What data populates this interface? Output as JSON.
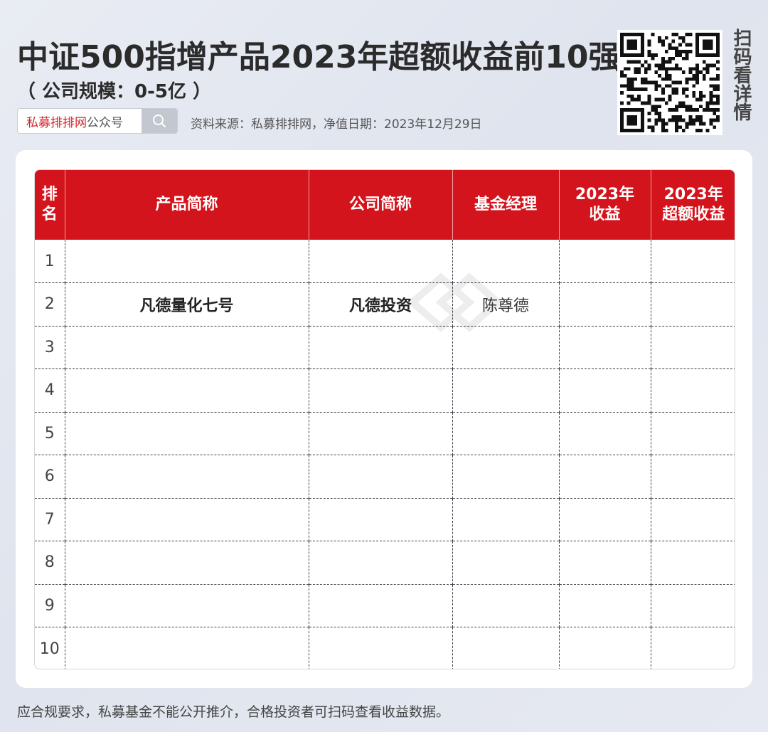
{
  "header": {
    "title": "中证500指增产品2023年超额收益前10强",
    "subtitle": "（ 公司规模：0-5亿 ）",
    "search_brand": "私募排排网",
    "search_suffix": "公众号",
    "source": "资料来源：私募排排网，净值日期：2023年12月29日",
    "scan_label": "扫码看详情"
  },
  "table": {
    "headers": [
      "排名",
      "产品简称",
      "公司简称",
      "基金经理",
      "2023年收益",
      "2023年超额收益"
    ],
    "header_lines": [
      [
        "排",
        "名"
      ],
      [
        "产品简称"
      ],
      [
        "公司简称"
      ],
      [
        "基金经理"
      ],
      [
        "2023年",
        "收益"
      ],
      [
        "2023年",
        "超额收益"
      ]
    ],
    "rows": [
      {
        "rank": "1",
        "product": "",
        "company": "",
        "manager": "",
        "return": "",
        "excess": ""
      },
      {
        "rank": "2",
        "product": "凡德量化七号",
        "company": "凡德投资",
        "manager": "陈尊德",
        "return": "",
        "excess": ""
      },
      {
        "rank": "3",
        "product": "",
        "company": "",
        "manager": "",
        "return": "",
        "excess": ""
      },
      {
        "rank": "4",
        "product": "",
        "company": "",
        "manager": "",
        "return": "",
        "excess": ""
      },
      {
        "rank": "5",
        "product": "",
        "company": "",
        "manager": "",
        "return": "",
        "excess": ""
      },
      {
        "rank": "6",
        "product": "",
        "company": "",
        "manager": "",
        "return": "",
        "excess": ""
      },
      {
        "rank": "7",
        "product": "",
        "company": "",
        "manager": "",
        "return": "",
        "excess": ""
      },
      {
        "rank": "8",
        "product": "",
        "company": "",
        "manager": "",
        "return": "",
        "excess": ""
      },
      {
        "rank": "9",
        "product": "",
        "company": "",
        "manager": "",
        "return": "",
        "excess": ""
      },
      {
        "rank": "10",
        "product": "",
        "company": "",
        "manager": "",
        "return": "",
        "excess": ""
      }
    ]
  },
  "footer": {
    "note": "应合规要求，私募基金不能公开推介，合格投资者可扫码查看收益数据。"
  },
  "colors": {
    "header_red": "#d4141c",
    "brand_red": "#d2232a"
  },
  "icons": {
    "search": "search-icon",
    "qr": "qr-code-icon"
  }
}
